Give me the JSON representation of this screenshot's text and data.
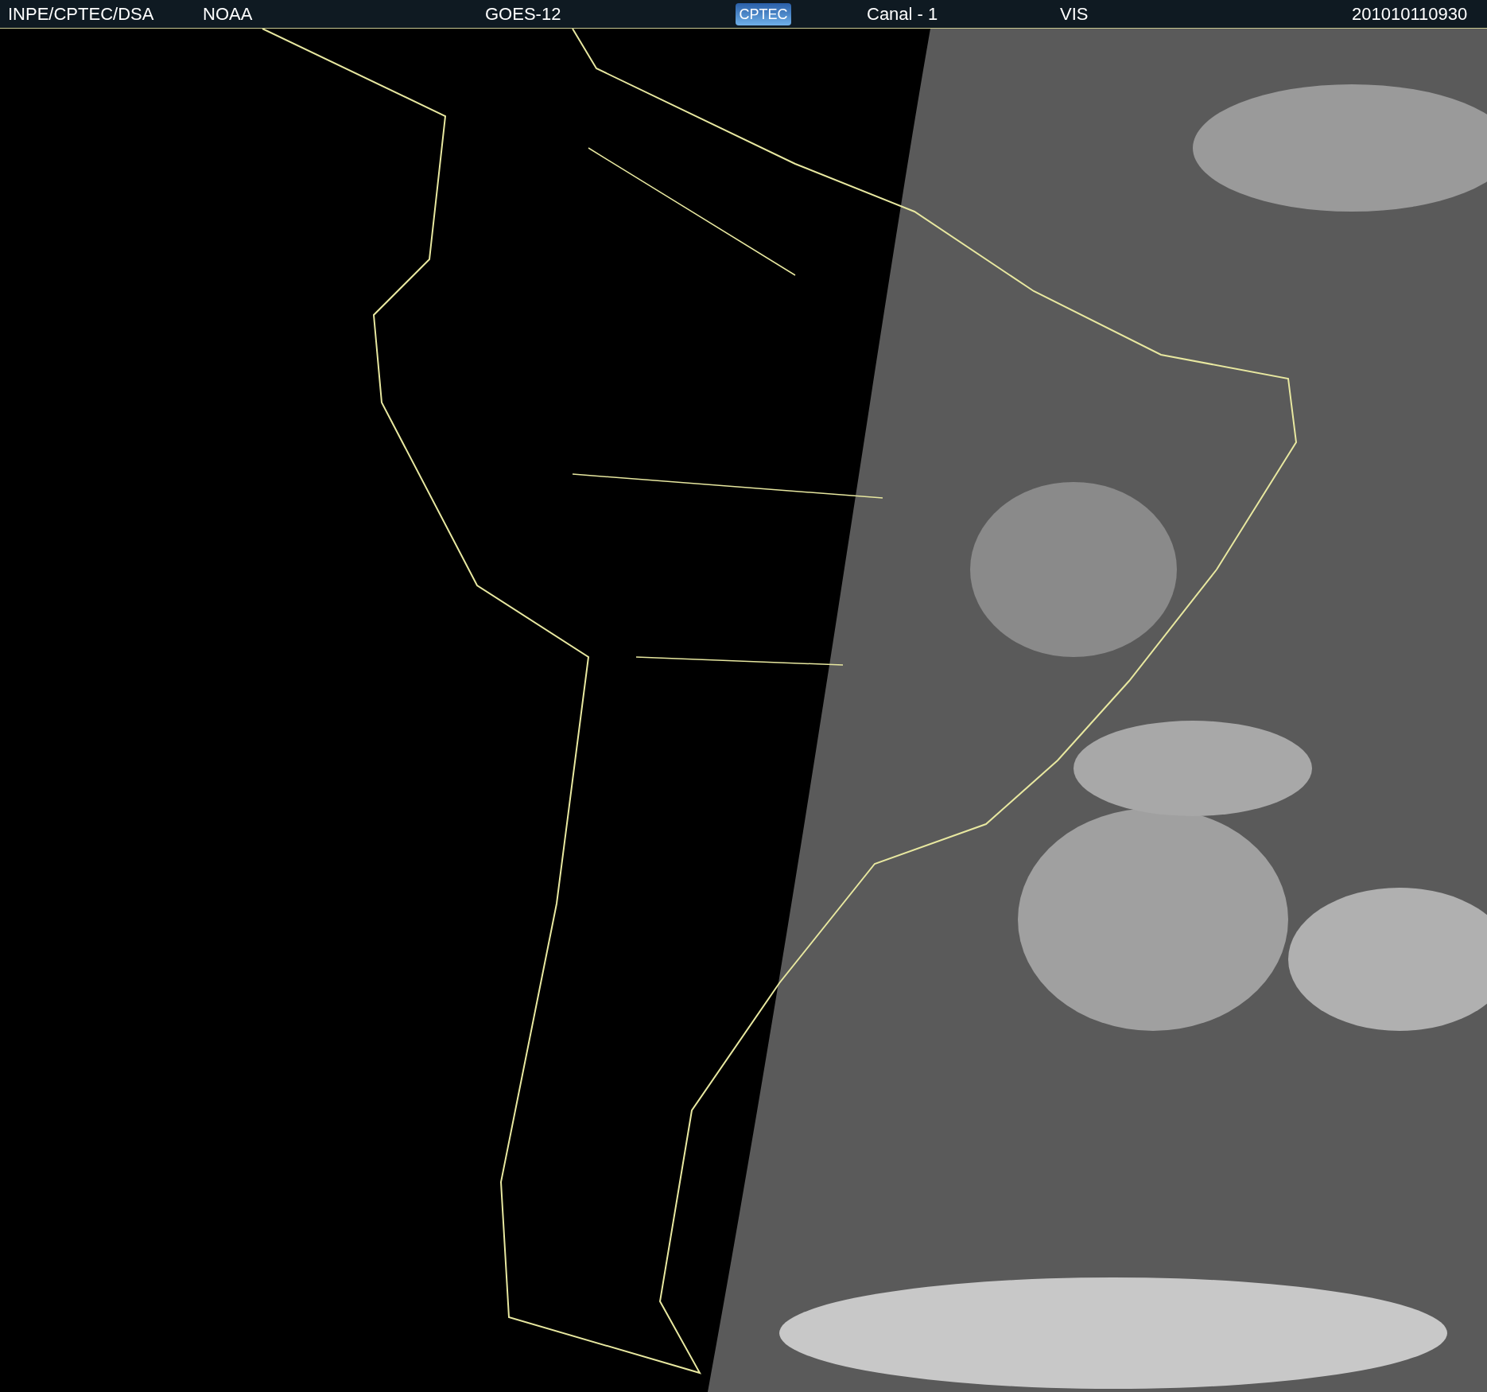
{
  "header": {
    "source": "INPE/CPTEC/DSA",
    "agency": "NOAA",
    "satellite": "GOES-12",
    "logo": "CPTEC",
    "channel": "Canal - 1",
    "band": "VIS",
    "timestamp": "201010110930"
  }
}
